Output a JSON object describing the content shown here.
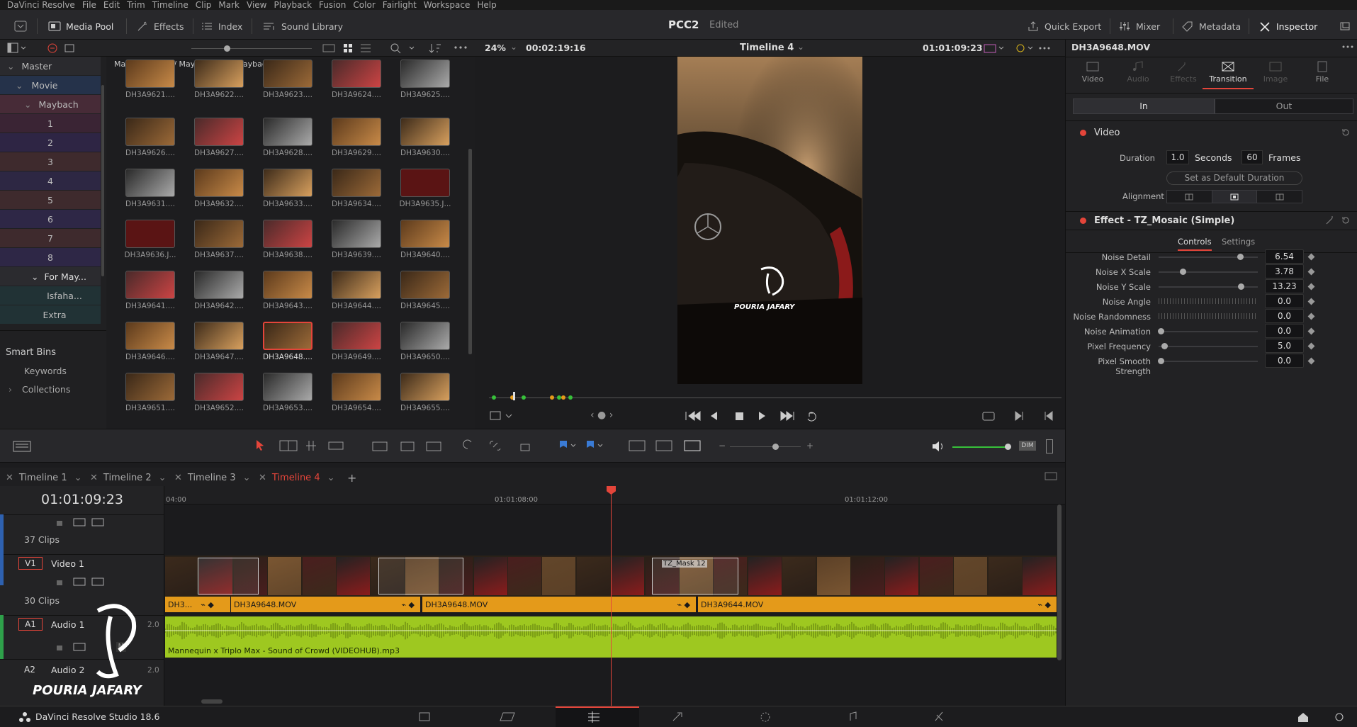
{
  "menu": [
    "DaVinci Resolve",
    "File",
    "Edit",
    "Trim",
    "Timeline",
    "Clip",
    "Mark",
    "View",
    "Playback",
    "Fusion",
    "Color",
    "Fairlight",
    "Workspace",
    "Help"
  ],
  "toolbar": {
    "media_pool": "Media Pool",
    "effects": "Effects",
    "index": "Index",
    "sound_library": "Sound Library",
    "project": "PCC2",
    "status": "Edited",
    "quick_export": "Quick Export",
    "mixer": "Mixer",
    "metadata": "Metadata",
    "inspector": "Inspector"
  },
  "mediapool": {
    "breadcrumb": "Master / Movie / Maybach / For Maybach",
    "bins": {
      "master": "Master",
      "movie": "Movie",
      "maybach": "Maybach",
      "n1": "1",
      "n2": "2",
      "n3": "3",
      "n4": "4",
      "n5": "5",
      "n6": "6",
      "n7": "7",
      "n8": "8",
      "formay": "For May...",
      "isfaha": "Isfaha...",
      "extra": "Extra"
    },
    "smart_bins": "Smart Bins",
    "keywords": "Keywords",
    "collections": "Collections",
    "clips": [
      "DH3A9621....",
      "DH3A9622....",
      "DH3A9623....",
      "DH3A9624....",
      "DH3A9625....",
      "DH3A9626....",
      "DH3A9627....",
      "DH3A9628....",
      "DH3A9629....",
      "DH3A9630....",
      "DH3A9631....",
      "DH3A9632....",
      "DH3A9633....",
      "DH3A9634....",
      "DH3A9635.J...",
      "DH3A9636.J...",
      "DH3A9637....",
      "DH3A9638....",
      "DH3A9639....",
      "DH3A9640....",
      "DH3A9641....",
      "DH3A9642....",
      "DH3A9643....",
      "DH3A9644....",
      "DH3A9645....",
      "DH3A9646....",
      "DH3A9647....",
      "DH3A9648....",
      "DH3A9649....",
      "DH3A9650....",
      "DH3A9651....",
      "DH3A9652....",
      "DH3A9653....",
      "DH3A9654....",
      "DH3A9655...."
    ]
  },
  "viewer": {
    "zoom": "24%",
    "duration": "00:02:19:16",
    "timeline": "Timeline 4",
    "timecode": "01:01:09:23",
    "watermark": "POURIA JAFARY"
  },
  "inspector": {
    "clip": "DH3A9648.MOV",
    "tabs": {
      "video": "Video",
      "audio": "Audio",
      "effects": "Effects",
      "transition": "Transition",
      "image": "Image",
      "file": "File"
    },
    "in": "In",
    "out": "Out",
    "section_video": "Video",
    "duration_lbl": "Duration",
    "duration_val": "1.0",
    "seconds": "Seconds",
    "frames_val": "60",
    "frames": "Frames",
    "set_default": "Set as Default Duration",
    "alignment": "Alignment",
    "effect": "Effect - TZ_Mosaic (Simple)",
    "controls": "Controls",
    "settings": "Settings",
    "params": [
      {
        "label": "Noise Detail",
        "value": "6.54",
        "pos": 0.82
      },
      {
        "label": "Noise X Scale",
        "value": "3.78",
        "pos": 0.24
      },
      {
        "label": "Noise Y Scale",
        "value": "13.23",
        "pos": 0.83
      },
      {
        "label": "Noise Angle",
        "value": "0.0",
        "pos": -1
      },
      {
        "label": "Noise Randomness",
        "value": "0.0",
        "pos": -1
      },
      {
        "label": "Noise Animation",
        "value": "0.0",
        "pos": 0.02
      },
      {
        "label": "Pixel Frequency",
        "value": "5.0",
        "pos": 0.06
      },
      {
        "label": "Pixel Smooth Strength",
        "value": "0.0",
        "pos": 0.02
      }
    ]
  },
  "timeline": {
    "tabs": [
      "Timeline 1",
      "Timeline 2",
      "Timeline 3",
      "Timeline 4"
    ],
    "timecode": "01:01:09:23",
    "ruler": [
      "04:00",
      "01:01:08:00",
      "01:01:12:00"
    ],
    "clips37": "37 Clips",
    "v1": "V1",
    "video1": "Video 1",
    "clips30": "30 Clips",
    "a1": "A1",
    "audio1": "Audio 1",
    "a1vol": "2.0",
    "a2": "A2",
    "audio2": "Audio 2",
    "a2vol": "2.0",
    "m": "M",
    "clip_labels": [
      "DH3...",
      "DH3A9648.MOV",
      "DH3A9648.MOV",
      "DH3A9644.MOV"
    ],
    "tz_mask": "TZ_Mask 12",
    "audio_clip": "Mannequin x Triplo Max - Sound of Crowd (VIDEOHUB).mp3",
    "watermark": "POURIA JAFARY"
  },
  "status": {
    "app": "DaVinci Resolve Studio 18.6"
  },
  "colors": {
    "accent": "#e4453a",
    "clip": "#e49a1a",
    "audio": "#9ec820"
  }
}
